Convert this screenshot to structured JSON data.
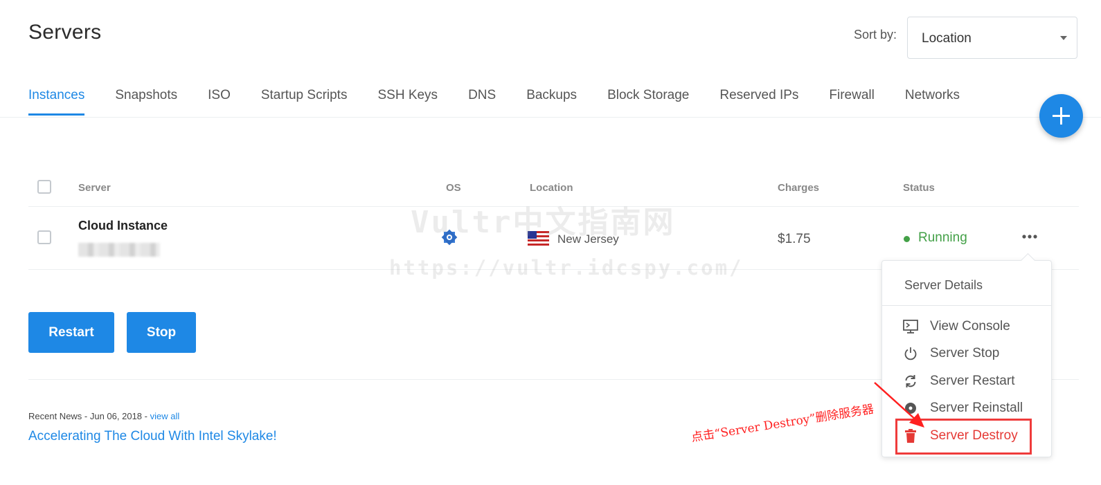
{
  "page": {
    "title": "Servers"
  },
  "sort": {
    "label": "Sort by:",
    "value": "Location"
  },
  "tabs": [
    {
      "label": "Instances",
      "active": true
    },
    {
      "label": "Snapshots"
    },
    {
      "label": "ISO"
    },
    {
      "label": "Startup Scripts"
    },
    {
      "label": "SSH Keys"
    },
    {
      "label": "DNS"
    },
    {
      "label": "Backups"
    },
    {
      "label": "Block Storage"
    },
    {
      "label": "Reserved IPs"
    },
    {
      "label": "Firewall"
    },
    {
      "label": "Networks"
    }
  ],
  "table": {
    "headers": {
      "server": "Server",
      "os": "OS",
      "location": "Location",
      "charges": "Charges",
      "status": "Status"
    },
    "rows": [
      {
        "name": "Cloud Instance",
        "os_icon": "os-logo-icon",
        "location": "New Jersey",
        "flag": "us-flag-icon",
        "charges": "$1.75",
        "status": "Running"
      }
    ]
  },
  "actions": {
    "restart": "Restart",
    "stop": "Stop"
  },
  "news": {
    "meta": "Recent News - Jun 06, 2018 - ",
    "view_all": "view all",
    "headline": "Accelerating The Cloud With Intel Skylake!"
  },
  "menu": {
    "header": "Server Details",
    "items": [
      {
        "label": "View Console",
        "icon": "console-icon"
      },
      {
        "label": "Server Stop",
        "icon": "power-icon"
      },
      {
        "label": "Server Restart",
        "icon": "restart-icon"
      },
      {
        "label": "Server Reinstall",
        "icon": "disc-icon"
      },
      {
        "label": "Server Destroy",
        "icon": "trash-icon"
      }
    ]
  },
  "annotation": {
    "text": "点击“Server Destroy”删除服务器"
  },
  "watermark": {
    "line1": "Vultr中文指南网",
    "line2": "https://vultr.idcspy.com/"
  },
  "colors": {
    "accent": "#1e88e5",
    "running": "#43a047",
    "danger": "#e53935",
    "annotation": "#ff2020"
  }
}
